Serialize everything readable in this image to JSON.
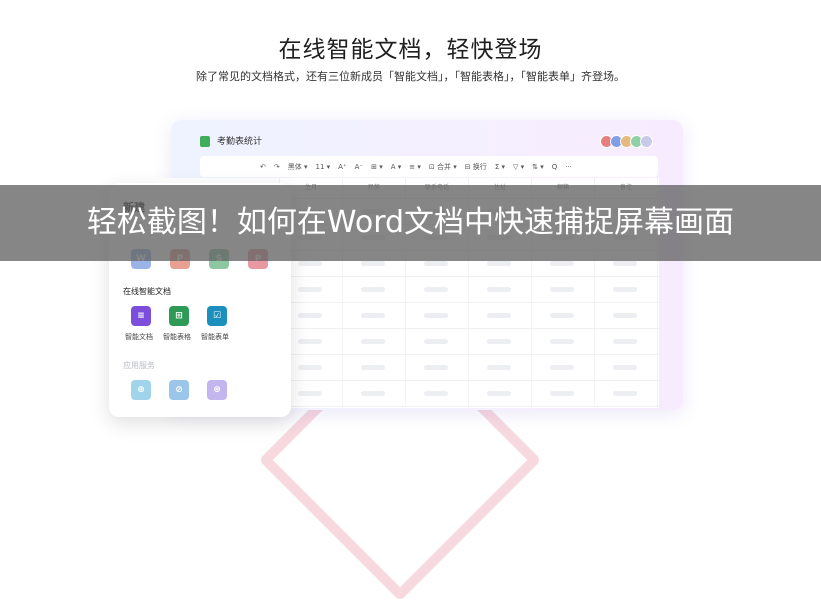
{
  "hero": {
    "title": "在线智能文档，轻快登场",
    "subtitle": "除了常见的文档格式，还有三位新成员「智能文档」，「智能表格」，「智能表单」齐登场。"
  },
  "window": {
    "doc_title": "考勤表统计",
    "toolbar": [
      "↶",
      "↷",
      "黑体 ▾",
      "11 ▾",
      "A⁺",
      "A⁻",
      "⊞ ▾",
      "A ▾",
      "≡ ▾",
      "⊡ 合并 ▾",
      "⊟ 换行",
      "Σ ▾",
      "▽ ▾",
      "⇅ ▾",
      "Q",
      "···"
    ],
    "columns": [
      "生月",
      "民族",
      "联系电话",
      "住址",
      "邮箱",
      "备注"
    ]
  },
  "panel": {
    "title": "新建",
    "file_types": [
      {
        "letter": "W",
        "color": "#4a78d6"
      },
      {
        "letter": "P",
        "color": "#d6543a"
      },
      {
        "letter": "S",
        "color": "#2f9a55"
      },
      {
        "letter": "P",
        "color": "#d64555"
      }
    ],
    "online_title": "在线智能文档",
    "online_items": [
      {
        "label": "智能文档",
        "color": "#7b4fdc",
        "glyph": "≡"
      },
      {
        "label": "智能表格",
        "color": "#2f9a55",
        "glyph": "⊞"
      },
      {
        "label": "智能表单",
        "color": "#1c8fbd",
        "glyph": "☑"
      }
    ],
    "services_title": "应用服务",
    "service_colors": [
      "#9fd4ea",
      "#9cc5ea",
      "#c3b5ee"
    ]
  },
  "banner": {
    "text": "轻松截图！如何在Word文档中快速捕捉屏幕画面"
  }
}
